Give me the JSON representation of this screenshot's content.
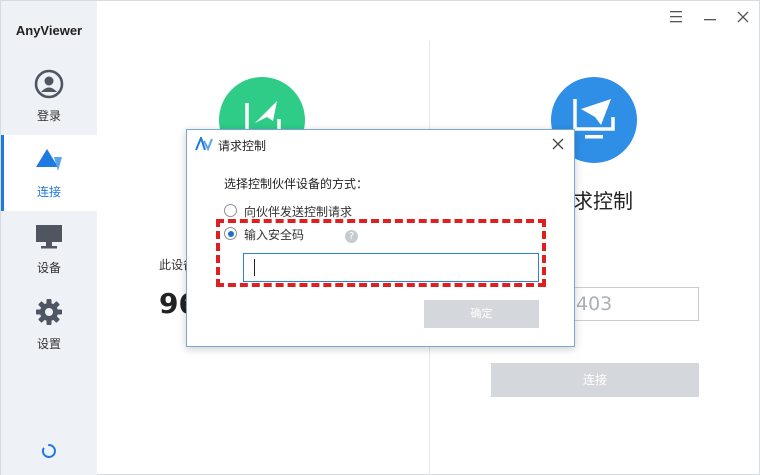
{
  "app": {
    "title": "AnyViewer"
  },
  "sidebar": {
    "items": [
      {
        "label": "登录",
        "icon": "user-icon"
      },
      {
        "label": "连接",
        "icon": "connect-icon",
        "active": true
      },
      {
        "label": "设备",
        "icon": "monitor-icon"
      },
      {
        "label": "设置",
        "icon": "gear-icon"
      }
    ],
    "status_icon": "loading-spinner-icon"
  },
  "window_controls": [
    "menu-icon",
    "minimize-icon",
    "close-icon"
  ],
  "background": {
    "right_title": "求控制",
    "device_label": "此设备",
    "device_id": "96",
    "partner_id_value": "403",
    "connect_label": "连接"
  },
  "dialog": {
    "title": "请求控制",
    "prompt": "选择控制伙伴设备的方式：",
    "options": [
      {
        "label": "向伙伴发送控制请求",
        "checked": false
      },
      {
        "label": "输入安全码",
        "checked": true
      }
    ],
    "code_value": "",
    "ok_label": "确定"
  },
  "colors": {
    "accent": "#1f7ae0",
    "sidebar_bg": "#eef1f6",
    "green_circle": "#2ecc87",
    "blue_circle": "#2f8fe6",
    "highlight": "#e02020",
    "disabled_button": "#d4d7dc"
  }
}
